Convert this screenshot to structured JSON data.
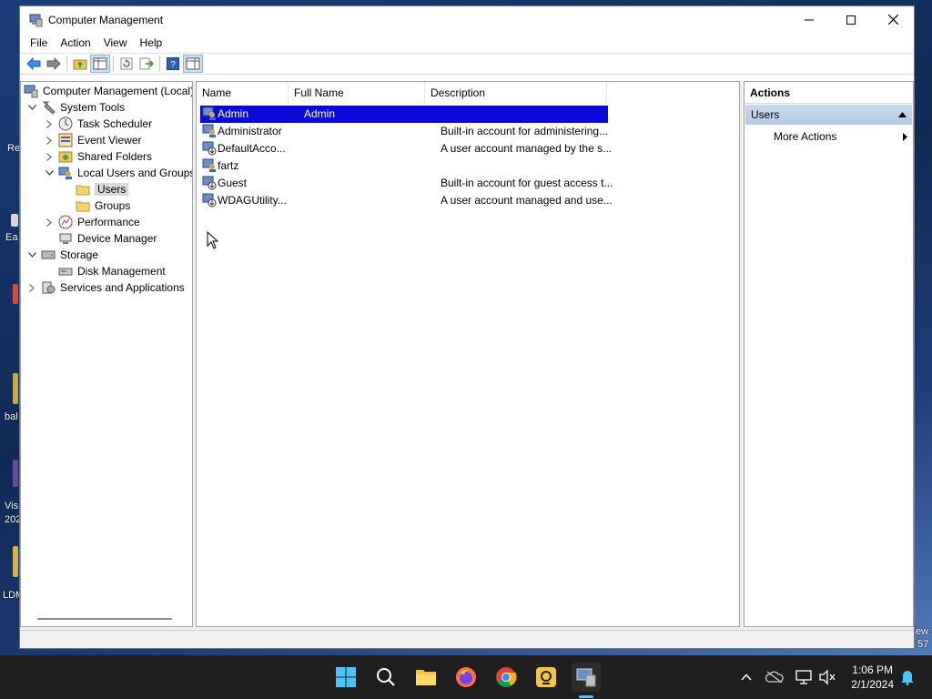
{
  "desktop": {
    "labels": [
      "Re",
      "Ea",
      "bal",
      "Vis",
      "202",
      "LDM",
      "ew",
      "57"
    ]
  },
  "window": {
    "title": "Computer Management"
  },
  "menu": [
    "File",
    "Action",
    "View",
    "Help"
  ],
  "tree": {
    "root": "Computer Management (Local)",
    "system_tools": "System Tools",
    "task_scheduler": "Task Scheduler",
    "event_viewer": "Event Viewer",
    "shared_folders": "Shared Folders",
    "local_users_groups": "Local Users and Groups",
    "users": "Users",
    "groups": "Groups",
    "performance": "Performance",
    "device_manager": "Device Manager",
    "storage": "Storage",
    "disk_management": "Disk Management",
    "services_apps": "Services and Applications"
  },
  "list": {
    "columns": [
      "Name",
      "Full Name",
      "Description"
    ],
    "rows": [
      {
        "name": "Admin",
        "full_name": "Admin",
        "description": ""
      },
      {
        "name": "Administrator",
        "full_name": "",
        "description": "Built-in account for administering..."
      },
      {
        "name": "DefaultAcco...",
        "full_name": "",
        "description": "A user account managed by the s..."
      },
      {
        "name": "fartz",
        "full_name": "",
        "description": ""
      },
      {
        "name": "Guest",
        "full_name": "",
        "description": "Built-in account for guest access t..."
      },
      {
        "name": "WDAGUtility...",
        "full_name": "",
        "description": "A user account managed and use..."
      }
    ]
  },
  "actions": {
    "header": "Actions",
    "group": "Users",
    "more": "More Actions"
  },
  "taskbar": {
    "time": "1:06 PM",
    "date": "2/1/2024"
  },
  "colors": {
    "selection": "#0a0ad8",
    "taskbar": "#1f1f1f",
    "accent": "#3a8ee6"
  }
}
